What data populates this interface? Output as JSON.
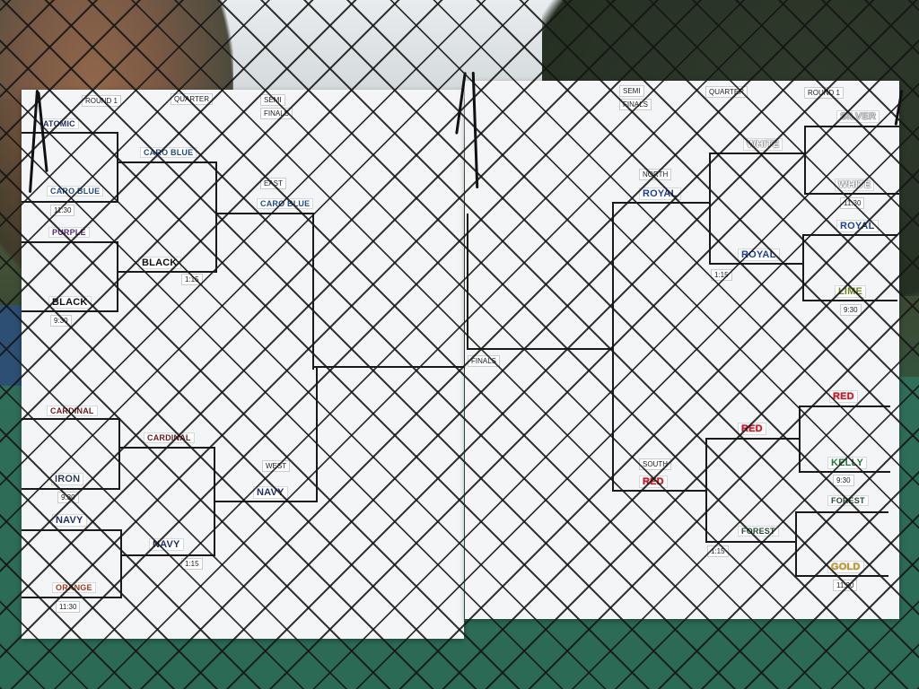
{
  "left_board": {
    "headers": {
      "round1": "ROUND 1",
      "quarter": "QUARTER",
      "semi_top": "SEMI",
      "semi_bottom": "FINALS"
    },
    "regions": {
      "east": "EAST",
      "west": "WEST"
    },
    "round1": [
      "ATOMIC",
      "CARO BLUE",
      "PURPLE",
      "BLACK",
      "CARDINAL",
      "IRON",
      "NAVY",
      "ORANGE"
    ],
    "round1_times": [
      "11:30",
      "9:30",
      "9:30",
      "11:30"
    ],
    "quarter": [
      "CARO BLUE",
      "BLACK",
      "CARDINAL",
      "NAVY"
    ],
    "quarter_times": [
      "1:15",
      "1:15"
    ],
    "semi": [
      "CARO BLUE",
      "NAVY"
    ]
  },
  "right_board": {
    "headers": {
      "semi_top": "SEMI",
      "semi_bottom": "FINALS",
      "quarter": "QUARTER",
      "round1": "ROUND 1"
    },
    "regions": {
      "north": "NORTH",
      "south": "SOUTH",
      "finals": "FINALS"
    },
    "round1": [
      "SILVER",
      "WHITE",
      "ROYAL",
      "LIME",
      "RED",
      "KELLY",
      "FOREST",
      "GOLD"
    ],
    "round1_times": [
      "11:30",
      "9:30",
      "9:30",
      "11:30"
    ],
    "quarter": [
      "WHITE",
      "ROYAL",
      "RED",
      "FOREST"
    ],
    "quarter_times": [
      "1:15",
      "1:15"
    ],
    "semi": [
      "ROYAL",
      "RED"
    ]
  }
}
